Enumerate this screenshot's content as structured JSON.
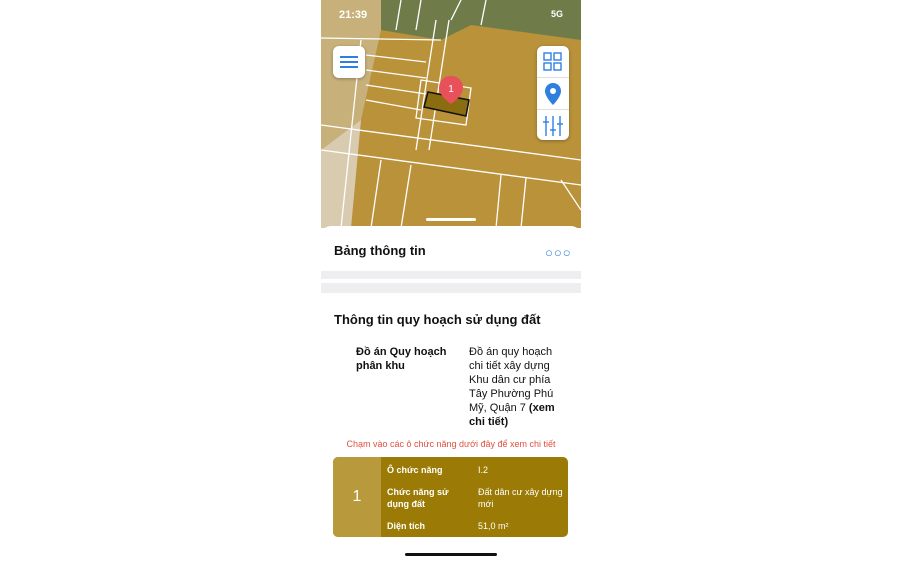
{
  "status": {
    "time": "21:39",
    "network": "5G"
  },
  "toolbar": {
    "menu_icon": "hamburger-icon",
    "tools": [
      "grid-icon",
      "location-pin-icon",
      "sliders-icon"
    ]
  },
  "map": {
    "marker_label": "1",
    "colors": {
      "zone": "#b9923a",
      "green": "#6f7c4a",
      "parcel": "#8a6d10"
    }
  },
  "panel": {
    "title": "Bảng thông tin",
    "more_icon": "more-dots-icon"
  },
  "planning": {
    "title": "Thông tin quy hoạch sử dụng đất",
    "project_label": "Đồ án Quy hoạch phân khu",
    "project_value": "Đồ án quy hoạch chi tiết xây dựng Khu dân cư phía Tây Phường Phú Mỹ, Quận 7",
    "detail_link": "(xem chi tiết)",
    "hint": "Chạm vào các ô chức năng dưới đây để xem chi tiết"
  },
  "lot_card": {
    "index": "1",
    "rows": [
      {
        "label": "Ô chức năng",
        "value": "I.2"
      },
      {
        "label": "Chức năng sử dụng đất",
        "value": "Đất dân cư xây dựng mới"
      },
      {
        "label": "Diện tích",
        "value": "51,0 m²"
      }
    ]
  }
}
